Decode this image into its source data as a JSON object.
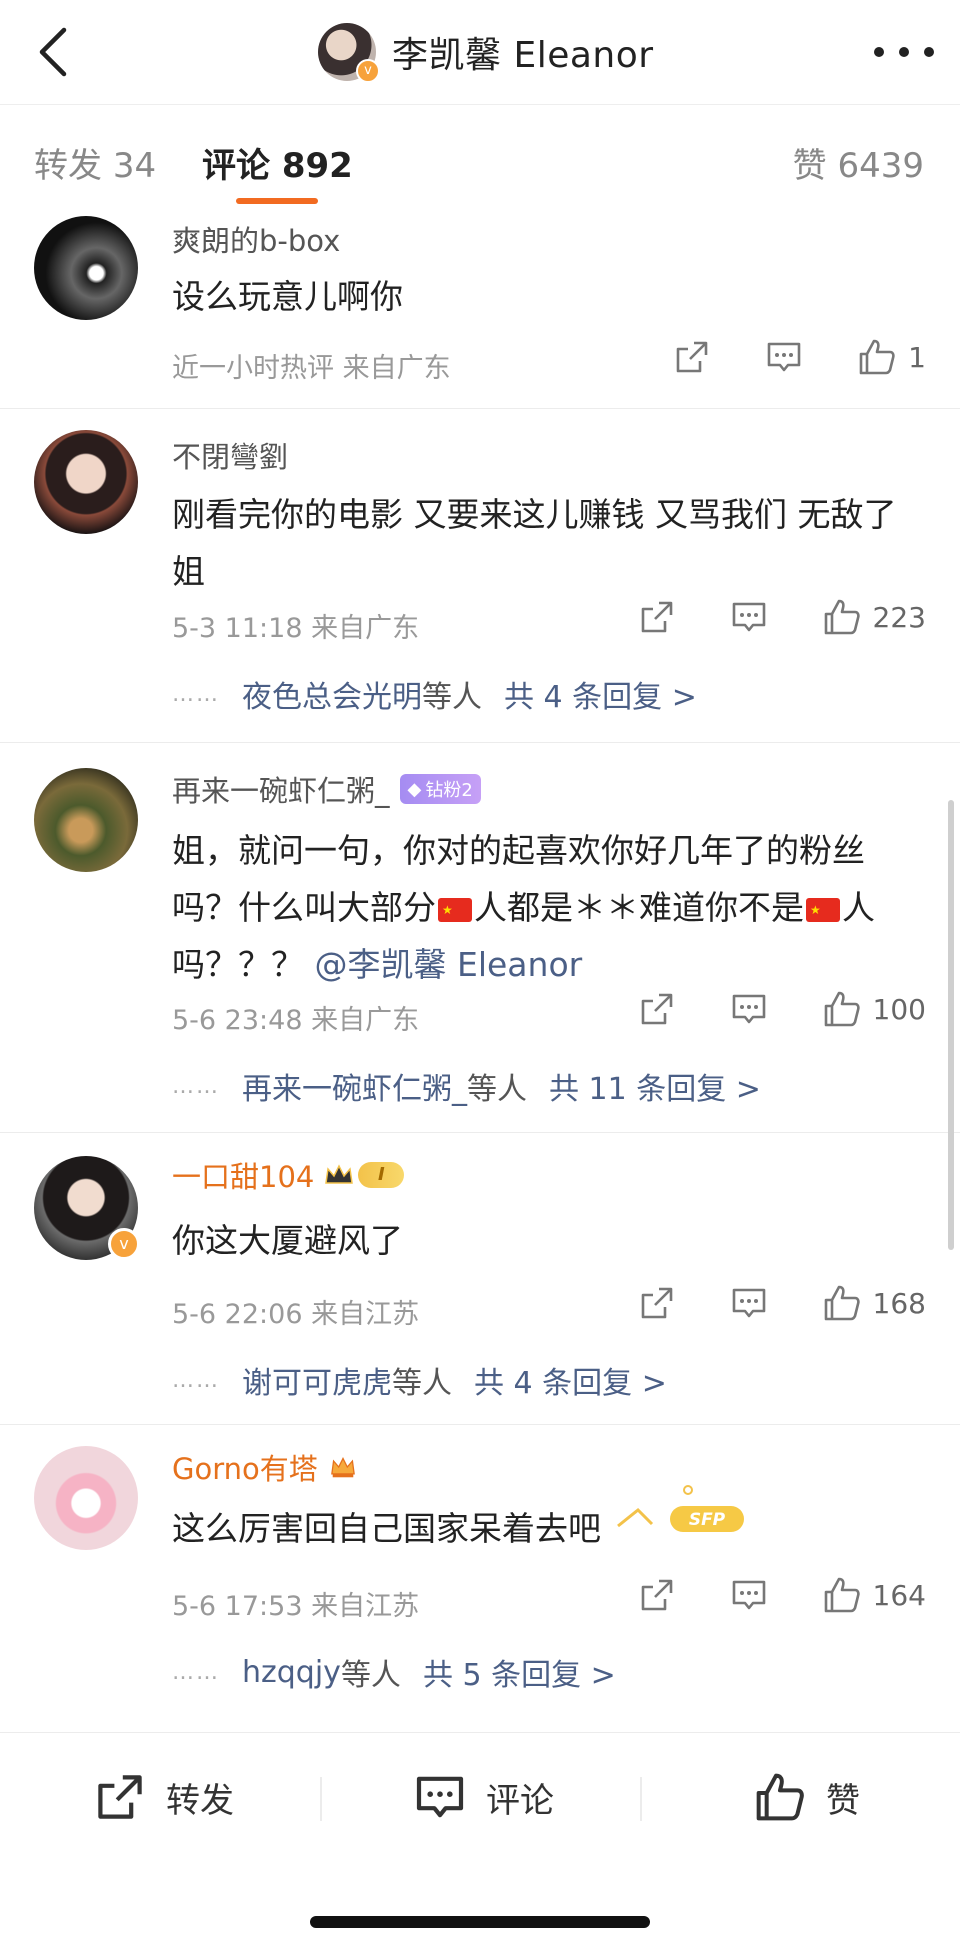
{
  "header": {
    "title": "李凯馨 Eleanor",
    "back_icon": "chevron-left-icon",
    "more_icon": "more-dots-icon"
  },
  "tabs": {
    "repost_label": "转发",
    "repost_count": "34",
    "comment_label": "评论",
    "comment_count": "892",
    "like_label": "赞",
    "like_count": "6439",
    "accent_color": "#f26b21"
  },
  "comments": [
    {
      "name": "爽朗的b-box",
      "text": "设么玩意儿啊你",
      "meta": "近一小时热评  来自广东",
      "likes": "1"
    },
    {
      "name": "不閉彎劉",
      "text": "刚看完你的电影 又要来这儿赚钱 又骂我们 无敌了姐",
      "meta": "5-3 11:18  来自广东",
      "likes": "223",
      "reply_user": "夜色总会光明",
      "reply_deng": "等人",
      "reply_total": "共 4 条回复 >"
    },
    {
      "name": "再来一碗虾仁粥_",
      "badge": "钻粉2",
      "text_a": "姐，就问一句，你对的起喜欢你好几年了的粉丝吗？什么叫大部分",
      "text_b": "人都是＊＊难道你不是",
      "text_c": "人吗？？？",
      "mention": "@李凯馨 Eleanor",
      "meta": "5-6 23:48  来自广东",
      "likes": "100",
      "reply_user": "再来一碗虾仁粥_",
      "reply_deng": "等人",
      "reply_total": "共 11 条回复 >"
    },
    {
      "name": "一口甜104",
      "level": "I",
      "text": "你这大厦避风了",
      "meta": "5-6 22:06  来自江苏",
      "likes": "168",
      "reply_user": "谢可可虎虎",
      "reply_deng": "等人",
      "reply_total": "共 4 条回复 >"
    },
    {
      "name": "Gorno有塔",
      "text": "这么厉害回自己国家呆着去吧",
      "meta": "5-6 17:53  来自江苏",
      "likes": "164",
      "reply_user": "hzqqjy",
      "reply_deng": "等人",
      "reply_total": "共 5 条回复 >",
      "sticker": "SFP"
    }
  ],
  "reply_dots": "……",
  "bottom": {
    "repost": "转发",
    "comment": "评论",
    "like": "赞"
  }
}
